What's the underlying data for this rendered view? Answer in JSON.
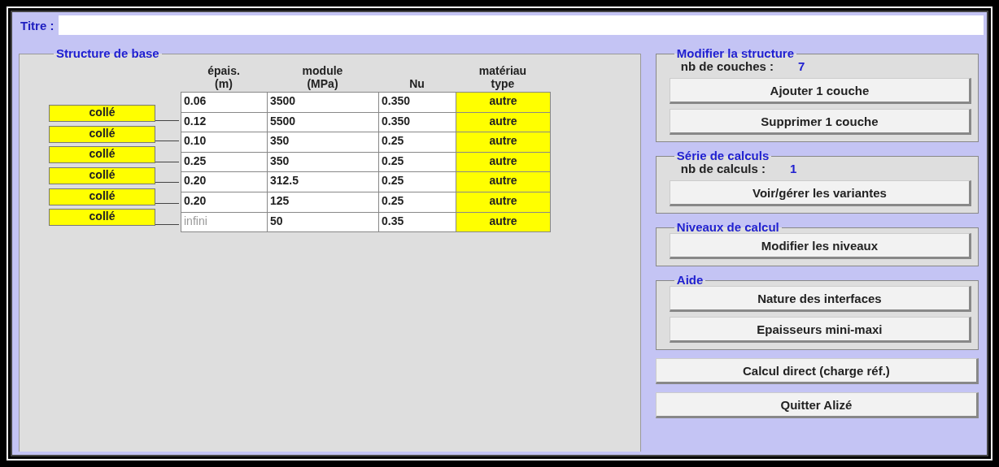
{
  "title": {
    "label": "Titre :"
  },
  "structure": {
    "legend": "Structure de base",
    "columns": [
      "épais.\n(m)",
      "module\n(MPa)",
      "Nu",
      "matériau\ntype"
    ],
    "rows": [
      {
        "thickness": "0.06",
        "modulus": "3500",
        "nu": "0.350",
        "material": "autre",
        "thickness_greyed": false
      },
      {
        "thickness": "0.12",
        "modulus": "5500",
        "nu": "0.350",
        "material": "autre",
        "thickness_greyed": false
      },
      {
        "thickness": "0.10",
        "modulus": "350",
        "nu": "0.25",
        "material": "autre",
        "thickness_greyed": false
      },
      {
        "thickness": "0.25",
        "modulus": "350",
        "nu": "0.25",
        "material": "autre",
        "thickness_greyed": false
      },
      {
        "thickness": "0.20",
        "modulus": "312.5",
        "nu": "0.25",
        "material": "autre",
        "thickness_greyed": false
      },
      {
        "thickness": "0.20",
        "modulus": "125",
        "nu": "0.25",
        "material": "autre",
        "thickness_greyed": false
      },
      {
        "thickness": "infini",
        "modulus": "50",
        "nu": "0.35",
        "material": "autre",
        "thickness_greyed": true
      }
    ],
    "interfaces": [
      "collé",
      "collé",
      "collé",
      "collé",
      "collé",
      "collé"
    ]
  },
  "groups": [
    {
      "legend": "Modifier la structure",
      "count_label": "nb de couches :",
      "count": "7",
      "buttons": [
        "Ajouter 1 couche",
        "Supprimer 1 couche"
      ]
    },
    {
      "legend": "Série de calculs",
      "count_label": "nb de calculs :",
      "count": "1",
      "buttons": [
        "Voir/gérer les variantes"
      ]
    },
    {
      "legend": "Niveaux de calcul",
      "buttons": [
        "Modifier les niveaux"
      ]
    },
    {
      "legend": "Aide",
      "buttons": [
        "Nature des interfaces",
        "Epaisseurs mini-maxi"
      ]
    }
  ],
  "actions": [
    "Calcul direct (charge réf.)",
    "Quitter Alizé"
  ]
}
